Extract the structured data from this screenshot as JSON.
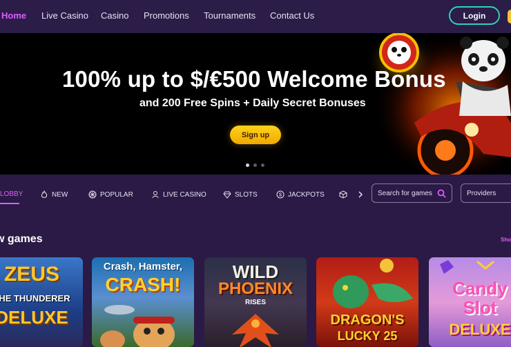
{
  "nav": {
    "items": [
      "Home",
      "Live Casino",
      "Casino",
      "Promotions",
      "Tournaments",
      "Contact Us"
    ],
    "login_label": "Login"
  },
  "hero": {
    "title": "100% up to $/€500 Welcome Bonus",
    "subtitle": "and 200 Free Spins + Daily Secret Bonuses",
    "cta_label": "Sign up",
    "slides": 3,
    "active_slide": 1
  },
  "categories": {
    "items": [
      "LOBBY",
      "NEW",
      "POPULAR",
      "LIVE CASINO",
      "SLOTS",
      "JACKPOTS"
    ],
    "search_placeholder": "Search for games",
    "providers_label": "Providers"
  },
  "section": {
    "title": "w games",
    "show_all": "Sho"
  },
  "games": [
    {
      "line1": "ZEUS",
      "line2": "THE THUNDERER",
      "line3": "DELUXE"
    },
    {
      "line1": "Crash, Hamster,",
      "line2": "CRASH!",
      "line3": ""
    },
    {
      "line1": "WILD",
      "line2": "PHOENIX",
      "line3": "RISES"
    },
    {
      "line1": "DRAGON'S",
      "line2": "LUCKY 25",
      "line3": ""
    },
    {
      "line1": "Candy",
      "line2": "Slot",
      "line3": "DELUXE"
    }
  ],
  "colors": {
    "background": "#2a1a45",
    "accent": "#e05cff",
    "login_border": "#2fd3b8",
    "cta": "#ffc815"
  }
}
